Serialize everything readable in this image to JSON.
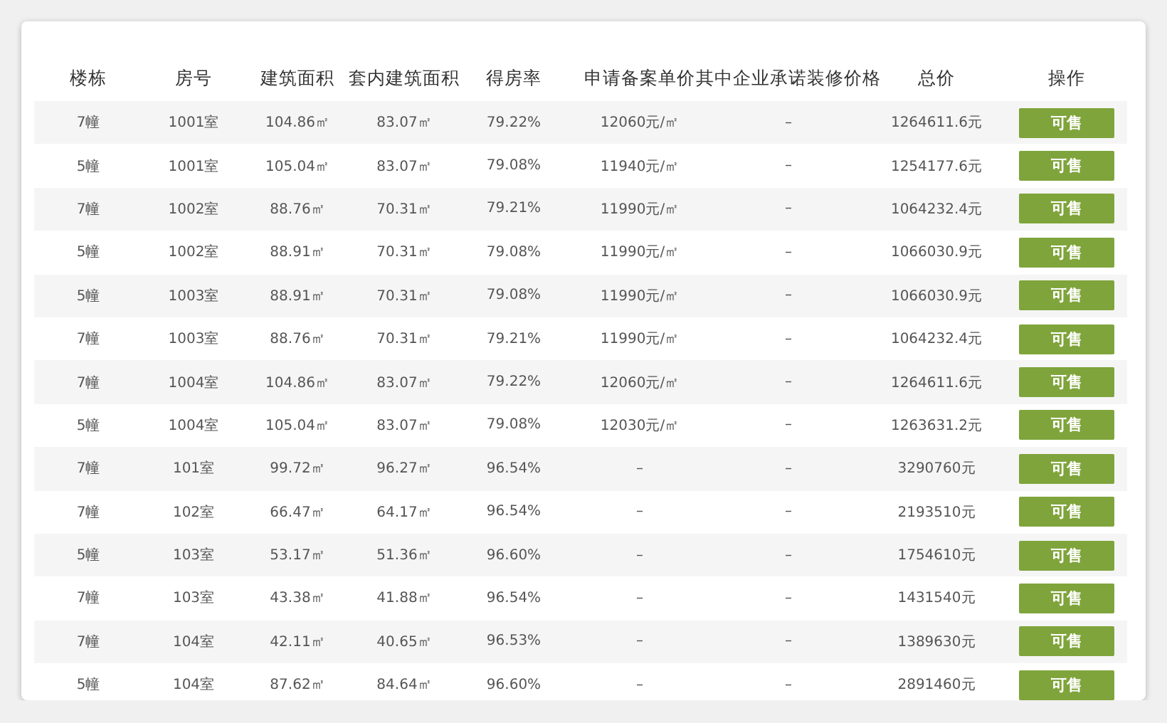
{
  "table": {
    "columns": [
      "楼栋",
      "房号",
      "建筑面积",
      "套内建筑面积",
      "得房率",
      "申请备案单价",
      "其中企业承诺装修价格",
      "总价",
      "操作"
    ],
    "rows": [
      {
        "cells": [
          "7幢",
          "1001室",
          "104.86㎡",
          "83.07㎡",
          "79.22%",
          "12060元/㎡",
          "–",
          "1264611.6元"
        ],
        "action": "可售"
      },
      {
        "cells": [
          "5幢",
          "1001室",
          "105.04㎡",
          "83.07㎡",
          "79.08%",
          "11940元/㎡",
          "–",
          "1254177.6元"
        ],
        "action": "可售"
      },
      {
        "cells": [
          "7幢",
          "1002室",
          "88.76㎡",
          "70.31㎡",
          "79.21%",
          "11990元/㎡",
          "–",
          "1064232.4元"
        ],
        "action": "可售"
      },
      {
        "cells": [
          "5幢",
          "1002室",
          "88.91㎡",
          "70.31㎡",
          "79.08%",
          "11990元/㎡",
          "–",
          "1066030.9元"
        ],
        "action": "可售"
      },
      {
        "cells": [
          "5幢",
          "1003室",
          "88.91㎡",
          "70.31㎡",
          "79.08%",
          "11990元/㎡",
          "–",
          "1066030.9元"
        ],
        "action": "可售"
      },
      {
        "cells": [
          "7幢",
          "1003室",
          "88.76㎡",
          "70.31㎡",
          "79.21%",
          "11990元/㎡",
          "–",
          "1064232.4元"
        ],
        "action": "可售"
      },
      {
        "cells": [
          "7幢",
          "1004室",
          "104.86㎡",
          "83.07㎡",
          "79.22%",
          "12060元/㎡",
          "–",
          "1264611.6元"
        ],
        "action": "可售"
      },
      {
        "cells": [
          "5幢",
          "1004室",
          "105.04㎡",
          "83.07㎡",
          "79.08%",
          "12030元/㎡",
          "–",
          "1263631.2元"
        ],
        "action": "可售"
      },
      {
        "cells": [
          "7幢",
          "101室",
          "99.72㎡",
          "96.27㎡",
          "96.54%",
          "–",
          "–",
          "3290760元"
        ],
        "action": "可售"
      },
      {
        "cells": [
          "7幢",
          "102室",
          "66.47㎡",
          "64.17㎡",
          "96.54%",
          "–",
          "–",
          "2193510元"
        ],
        "action": "可售"
      },
      {
        "cells": [
          "5幢",
          "103室",
          "53.17㎡",
          "51.36㎡",
          "96.60%",
          "–",
          "–",
          "1754610元"
        ],
        "action": "可售"
      },
      {
        "cells": [
          "7幢",
          "103室",
          "43.38㎡",
          "41.88㎡",
          "96.54%",
          "–",
          "–",
          "1431540元"
        ],
        "action": "可售"
      },
      {
        "cells": [
          "7幢",
          "104室",
          "42.11㎡",
          "40.65㎡",
          "96.53%",
          "–",
          "–",
          "1389630元"
        ],
        "action": "可售"
      },
      {
        "cells": [
          "5幢",
          "104室",
          "87.62㎡",
          "84.64㎡",
          "96.60%",
          "–",
          "–",
          "2891460元"
        ],
        "action": "可售"
      }
    ]
  }
}
